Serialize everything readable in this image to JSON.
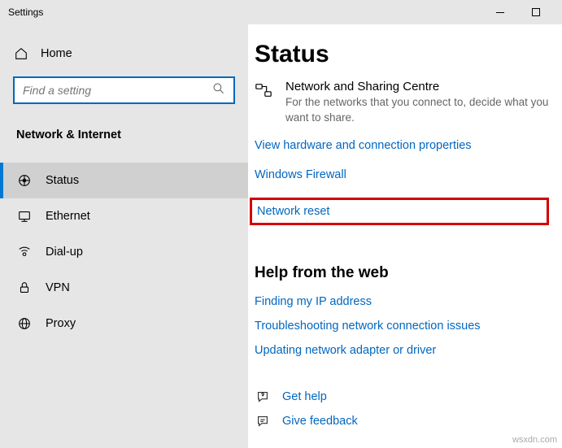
{
  "window": {
    "title": "Settings"
  },
  "sidebar": {
    "home": "Home",
    "search": {
      "placeholder": "Find a setting"
    },
    "section": "Network & Internet",
    "items": [
      {
        "label": "Status"
      },
      {
        "label": "Ethernet"
      },
      {
        "label": "Dial-up"
      },
      {
        "label": "VPN"
      },
      {
        "label": "Proxy"
      }
    ]
  },
  "main": {
    "title": "Status",
    "sharing": {
      "title": "Network and Sharing Centre",
      "desc": "For the networks that you connect to, decide what you want to share."
    },
    "links": {
      "hw": "View hardware and connection properties",
      "fw": "Windows Firewall",
      "reset": "Network reset"
    },
    "help": {
      "title": "Help from the web",
      "ip": "Finding my IP address",
      "troubleshoot": "Troubleshooting network connection issues",
      "adapter": "Updating network adapter or driver"
    },
    "footer": {
      "gethelp": "Get help",
      "feedback": "Give feedback"
    }
  },
  "watermark": "wsxdn.com"
}
